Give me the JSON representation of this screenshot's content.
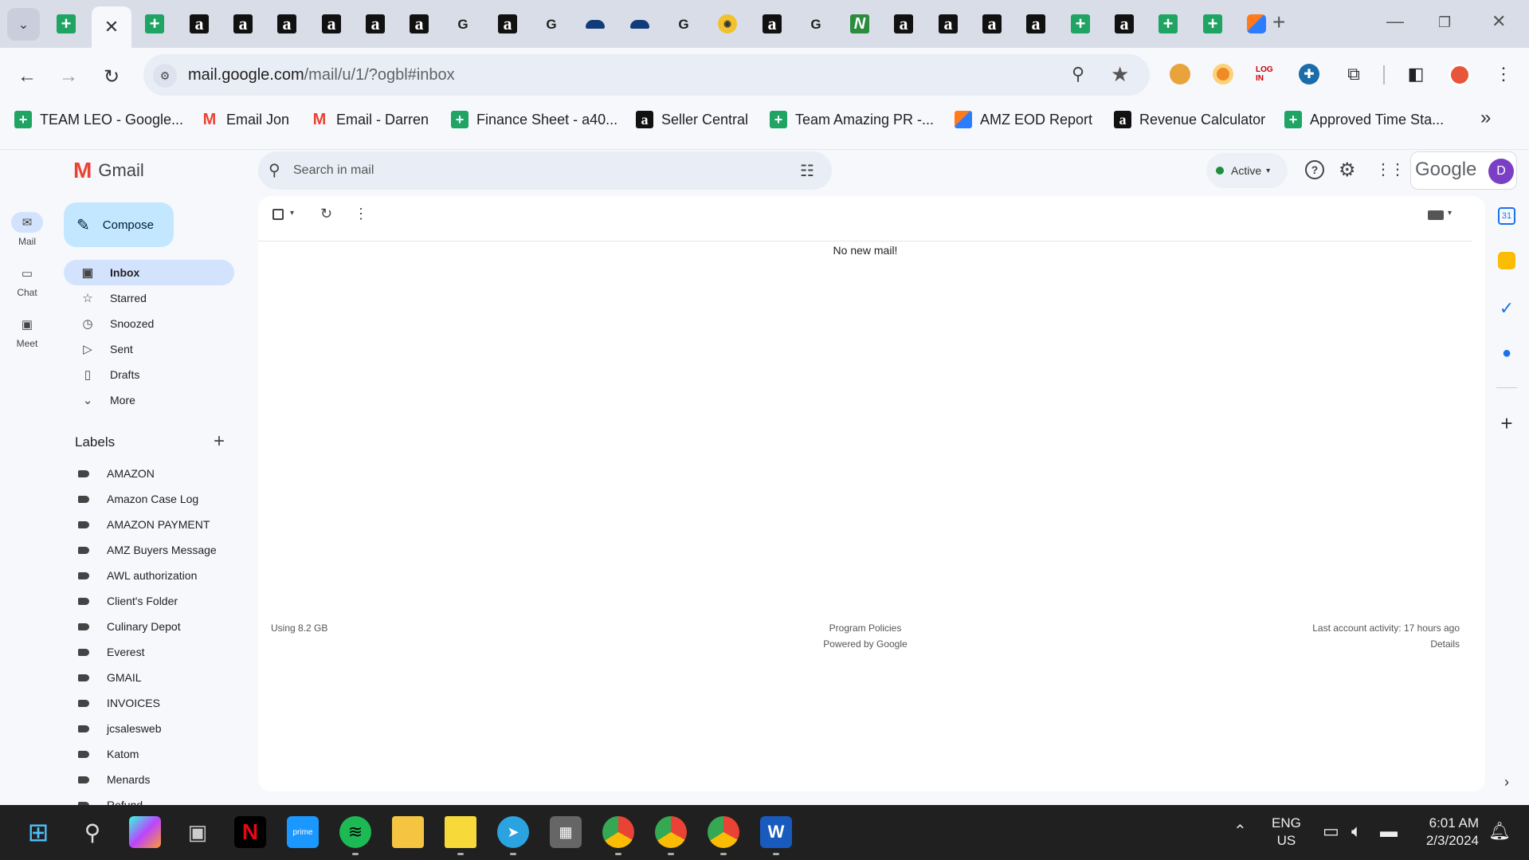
{
  "browser": {
    "tabs": [
      "sheet",
      "sheet",
      "amz",
      "amz",
      "amz",
      "amz",
      "amz",
      "amz",
      "google",
      "amz",
      "google",
      "cap",
      "cap",
      "google",
      "bee",
      "amz",
      "google",
      "n",
      "amz",
      "amz",
      "amz",
      "amz",
      "sheet",
      "amz",
      "sheet",
      "sheet",
      "amzeod"
    ],
    "active_tab_close": "✕",
    "new_tab": "+",
    "url_host": "mail.google.com",
    "url_path": "/mail/u/1/?ogbl#inbox",
    "bookmarks": [
      {
        "icon": "sheet",
        "label": "TEAM LEO - Google..."
      },
      {
        "icon": "gmail",
        "label": "Email Jon"
      },
      {
        "icon": "gmail",
        "label": "Email - Darren"
      },
      {
        "icon": "sheet",
        "label": "Finance Sheet - a40..."
      },
      {
        "icon": "amz",
        "label": "Seller Central"
      },
      {
        "icon": "sheet",
        "label": "Team Amazing PR -..."
      },
      {
        "icon": "eod",
        "label": "AMZ EOD Report"
      },
      {
        "icon": "amz",
        "label": "Revenue Calculator"
      },
      {
        "icon": "sheet",
        "label": "Approved Time Sta..."
      }
    ]
  },
  "gmail": {
    "app_name": "Gmail",
    "search_placeholder": "Search in mail",
    "status": "Active",
    "account_brand": "Google",
    "avatar_letter": "D",
    "rail": [
      {
        "label": "Mail",
        "icon": "mail-icon"
      },
      {
        "label": "Chat",
        "icon": "chat-icon"
      },
      {
        "label": "Meet",
        "icon": "meet-icon"
      }
    ],
    "compose_label": "Compose",
    "nav": [
      {
        "label": "Inbox",
        "icon": "inbox-icon",
        "active": true
      },
      {
        "label": "Starred",
        "icon": "star-icon"
      },
      {
        "label": "Snoozed",
        "icon": "clock-icon"
      },
      {
        "label": "Sent",
        "icon": "send-icon"
      },
      {
        "label": "Drafts",
        "icon": "draft-icon"
      },
      {
        "label": "More",
        "icon": "chevron-down-icon"
      }
    ],
    "labels_title": "Labels",
    "labels": [
      "AMAZON",
      "Amazon Case Log",
      "AMAZON PAYMENT",
      "AMZ Buyers Message",
      "AWL authorization",
      "Client's Folder",
      "Culinary Depot",
      "Everest",
      "GMAIL",
      "INVOICES",
      "jcsalesweb",
      "Katom",
      "Menards",
      "Refund"
    ],
    "empty_message": "No new mail!",
    "footer": {
      "storage": "Using 8.2 GB",
      "policies": "Program Policies",
      "powered": "Powered by Google",
      "activity": "Last account activity: 17 hours ago",
      "details": "Details"
    }
  },
  "taskbar": {
    "language": "ENG",
    "region": "US",
    "time": "6:01 AM",
    "date": "2/3/2024"
  },
  "colors": {
    "accent": "#0b57d0",
    "compose_bg": "#c2e7ff",
    "active_nav_bg": "#d3e3fd",
    "avatar": "#7b3fc6",
    "status_green": "#1e8e3e"
  }
}
